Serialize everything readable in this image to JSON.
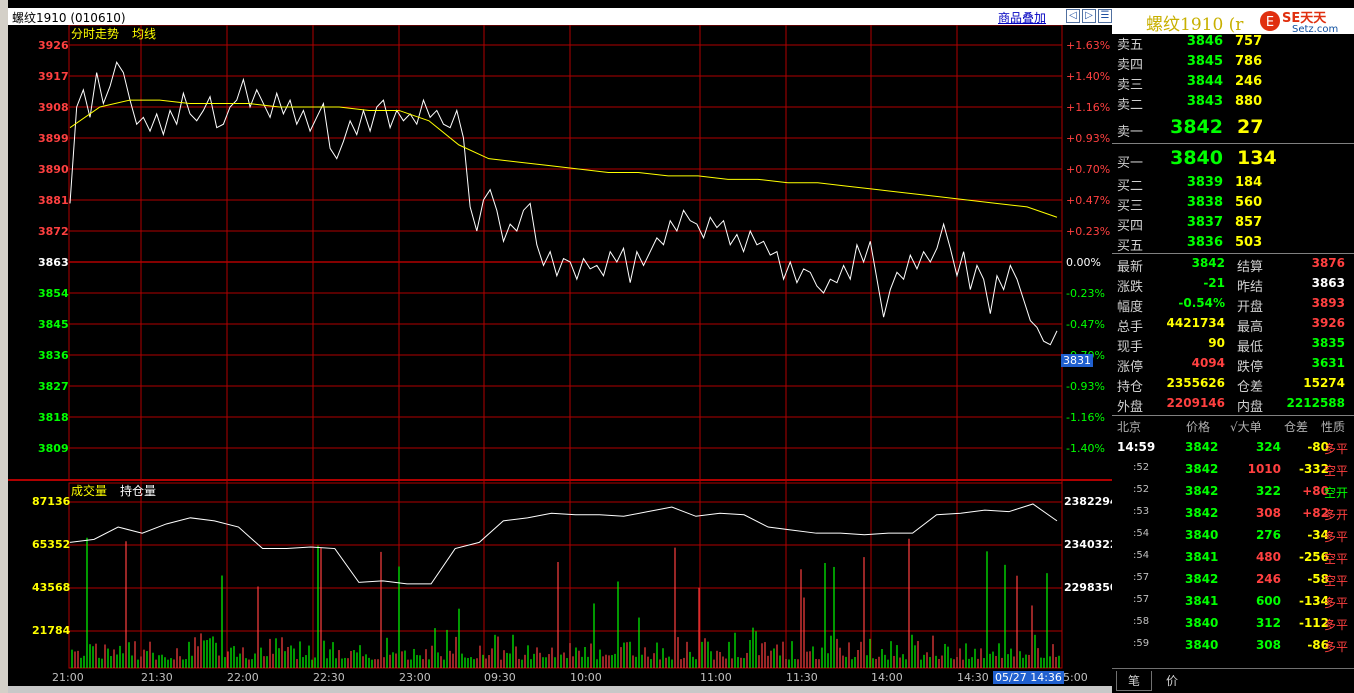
{
  "window": {
    "title": "螺纹1910 (010610)",
    "overlay_link": "商品叠加",
    "buttons": [
      "◁",
      "▷",
      "☰"
    ]
  },
  "price_panel": {
    "label_trend": "分时走势",
    "label_avg": "均线",
    "left_ticks": [
      "3926",
      "3917",
      "3908",
      "3899",
      "3890",
      "3881",
      "3872",
      "3863",
      "3854",
      "3845",
      "3836",
      "3827",
      "3818",
      "3809"
    ],
    "right_ticks": [
      "+1.63%",
      "+1.40%",
      "+1.16%",
      "+0.93%",
      "+0.70%",
      "+0.47%",
      "+0.23%",
      "0.00%",
      "-0.23%",
      "-0.47%",
      "-0.70%",
      "-0.93%",
      "-1.16%",
      "-1.40%"
    ],
    "cursor_price": "3831"
  },
  "volume_panel": {
    "label_volume": "成交量",
    "label_oi": "持仓量",
    "left_ticks": [
      "87136",
      "65352",
      "43568",
      "21784"
    ],
    "right_ticks": [
      "2382294",
      "2340322",
      "2298350"
    ],
    "time_ticks": [
      "21:00",
      "21:30",
      "22:00",
      "22:30",
      "23:00",
      "09:30",
      "10:00",
      "11:00",
      "11:30",
      "14:00",
      "14:30",
      "15:00"
    ],
    "cursor_time": "05/27 14:36"
  },
  "chart_data": {
    "type": "line",
    "title": "",
    "prev_settle": 3863,
    "ylim": [
      3805,
      3930
    ],
    "price_series": [
      3880,
      3908,
      3913,
      3905,
      3918,
      3909,
      3914,
      3921,
      3918,
      3910,
      3903,
      3905,
      3901,
      3906,
      3900,
      3907,
      3903,
      3912,
      3906,
      3904,
      3907,
      3911,
      3902,
      3903,
      3908,
      3910,
      3916,
      3908,
      3913,
      3909,
      3905,
      3912,
      3906,
      3910,
      3903,
      3907,
      3901,
      3905,
      3909,
      3896,
      3893,
      3898,
      3904,
      3900,
      3907,
      3901,
      3908,
      3910,
      3902,
      3907,
      3904,
      3906,
      3903,
      3910,
      3905,
      3907,
      3903,
      3902,
      3907,
      3899,
      3879,
      3872,
      3881,
      3884,
      3878,
      3869,
      3874,
      3872,
      3878,
      3880,
      3868,
      3862,
      3866,
      3859,
      3864,
      3863,
      3858,
      3864,
      3861,
      3862,
      3859,
      3866,
      3863,
      3867,
      3857,
      3866,
      3862,
      3866,
      3870,
      3868,
      3875,
      3872,
      3878,
      3875,
      3874,
      3870,
      3876,
      3873,
      3875,
      3868,
      3871,
      3866,
      3872,
      3868,
      3869,
      3865,
      3866,
      3858,
      3863,
      3857,
      3861,
      3860,
      3856,
      3854,
      3858,
      3857,
      3862,
      3858,
      3868,
      3863,
      3869,
      3858,
      3847,
      3855,
      3860,
      3858,
      3865,
      3861,
      3866,
      3863,
      3867,
      3874,
      3867,
      3859,
      3866,
      3855,
      3862,
      3858,
      3848,
      3859,
      3855,
      3862,
      3858,
      3852,
      3846,
      3844,
      3840,
      3839,
      3843
    ],
    "avg_series": [
      3902,
      3908,
      3910,
      3910,
      3909,
      3909,
      3909,
      3908,
      3908,
      3908,
      3907,
      3907,
      3904,
      3897,
      3893,
      3892,
      3891,
      3890,
      3889,
      3889,
      3888,
      3888,
      3887,
      3887,
      3886,
      3886,
      3885,
      3884,
      3883,
      3882,
      3881,
      3880,
      3879,
      3876
    ],
    "volume_ylim": [
      0,
      87136
    ],
    "oi_ylim": [
      2298350,
      2382294
    ],
    "oi_series": [
      2356000,
      2358000,
      2366000,
      2362000,
      2368000,
      2372000,
      2370000,
      2366000,
      2352000,
      2352000,
      2353000,
      2352000,
      2330000,
      2331000,
      2329000,
      2329000,
      2352000,
      2356000,
      2370000,
      2372000,
      2375000,
      2374000,
      2374000,
      2373000,
      2376000,
      2379000,
      2373000,
      2375000,
      2374000,
      2366000,
      2364000,
      2362000,
      2362000,
      2361000,
      2362000,
      2362000,
      2374000,
      2375000,
      2377000,
      2376000,
      2381000,
      2370000
    ]
  },
  "quote": {
    "name": "螺纹1910 (r",
    "asks": [
      {
        "label": "卖五",
        "price": "3846",
        "vol": "757"
      },
      {
        "label": "卖四",
        "price": "3845",
        "vol": "786"
      },
      {
        "label": "卖三",
        "price": "3844",
        "vol": "246"
      },
      {
        "label": "卖二",
        "price": "3843",
        "vol": "880"
      }
    ],
    "ask1": {
      "label": "卖一",
      "price": "3842",
      "vol": "27"
    },
    "bid1": {
      "label": "买一",
      "price": "3840",
      "vol": "134"
    },
    "bids": [
      {
        "label": "买二",
        "price": "3839",
        "vol": "184"
      },
      {
        "label": "买三",
        "price": "3838",
        "vol": "560"
      },
      {
        "label": "买四",
        "price": "3837",
        "vol": "857"
      },
      {
        "label": "买五",
        "price": "3836",
        "vol": "503"
      }
    ],
    "stats": [
      {
        "k1": "最新",
        "v1": "3842",
        "c1": "grn",
        "k2": "结算",
        "v2": "3876",
        "c2": "red"
      },
      {
        "k1": "涨跌",
        "v1": "-21",
        "c1": "grn",
        "k2": "昨结",
        "v2": "3863",
        "c2": "wht"
      },
      {
        "k1": "幅度",
        "v1": "-0.54%",
        "c1": "grn",
        "k2": "开盘",
        "v2": "3893",
        "c2": "red"
      },
      {
        "k1": "总手",
        "v1": "4421734",
        "c1": "yel",
        "k2": "最高",
        "v2": "3926",
        "c2": "red"
      },
      {
        "k1": "现手",
        "v1": "90",
        "c1": "yel",
        "k2": "最低",
        "v2": "3835",
        "c2": "grn"
      },
      {
        "k1": "涨停",
        "v1": "4094",
        "c1": "red",
        "k2": "跌停",
        "v2": "3631",
        "c2": "grn"
      },
      {
        "k1": "持仓",
        "v1": "2355626",
        "c1": "yel",
        "k2": "仓差",
        "v2": "15274",
        "c2": "yel"
      },
      {
        "k1": "外盘",
        "v1": "2209146",
        "c1": "red",
        "k2": "内盘",
        "v2": "2212588",
        "c2": "grn"
      }
    ],
    "ticks_header": {
      "loc": "北京",
      "price": "价格",
      "big": "√大单",
      "oi": "仓差",
      "nature": "性质"
    },
    "ticks": [
      {
        "time": "14:59",
        "price": "3842",
        "vol": "324",
        "vc": "grn",
        "diff": "-80",
        "nature": "多平",
        "nc": "red"
      },
      {
        "time": ":52",
        "price": "3842",
        "vol": "1010",
        "vc": "red",
        "diff": "-332",
        "nature": "空平",
        "nc": "red"
      },
      {
        "time": ":52",
        "price": "3842",
        "vol": "322",
        "vc": "grn",
        "diff": "+80",
        "nature": "空开",
        "nc": "grn"
      },
      {
        "time": ":53",
        "price": "3842",
        "vol": "308",
        "vc": "red",
        "diff": "+82",
        "nature": "多开",
        "nc": "red"
      },
      {
        "time": ":54",
        "price": "3840",
        "vol": "276",
        "vc": "grn",
        "diff": "-34",
        "nature": "多平",
        "nc": "red"
      },
      {
        "time": ":54",
        "price": "3841",
        "vol": "480",
        "vc": "red",
        "diff": "-256",
        "nature": "空平",
        "nc": "red"
      },
      {
        "time": ":57",
        "price": "3842",
        "vol": "246",
        "vc": "red",
        "diff": "-58",
        "nature": "空平",
        "nc": "red"
      },
      {
        "time": ":57",
        "price": "3841",
        "vol": "600",
        "vc": "grn",
        "diff": "-134",
        "nature": "多平",
        "nc": "red"
      },
      {
        "time": ":58",
        "price": "3840",
        "vol": "312",
        "vc": "grn",
        "diff": "-112",
        "nature": "多平",
        "nc": "red"
      },
      {
        "time": ":59",
        "price": "3840",
        "vol": "308",
        "vc": "grn",
        "diff": "-86",
        "nature": "多平",
        "nc": "red"
      }
    ],
    "tabs": [
      "笔",
      "价"
    ]
  },
  "colors": {
    "up": "#ff4040",
    "down": "#00ff00",
    "grid": "#b00000",
    "avg": "#ffff00",
    "price": "#ffffff"
  }
}
